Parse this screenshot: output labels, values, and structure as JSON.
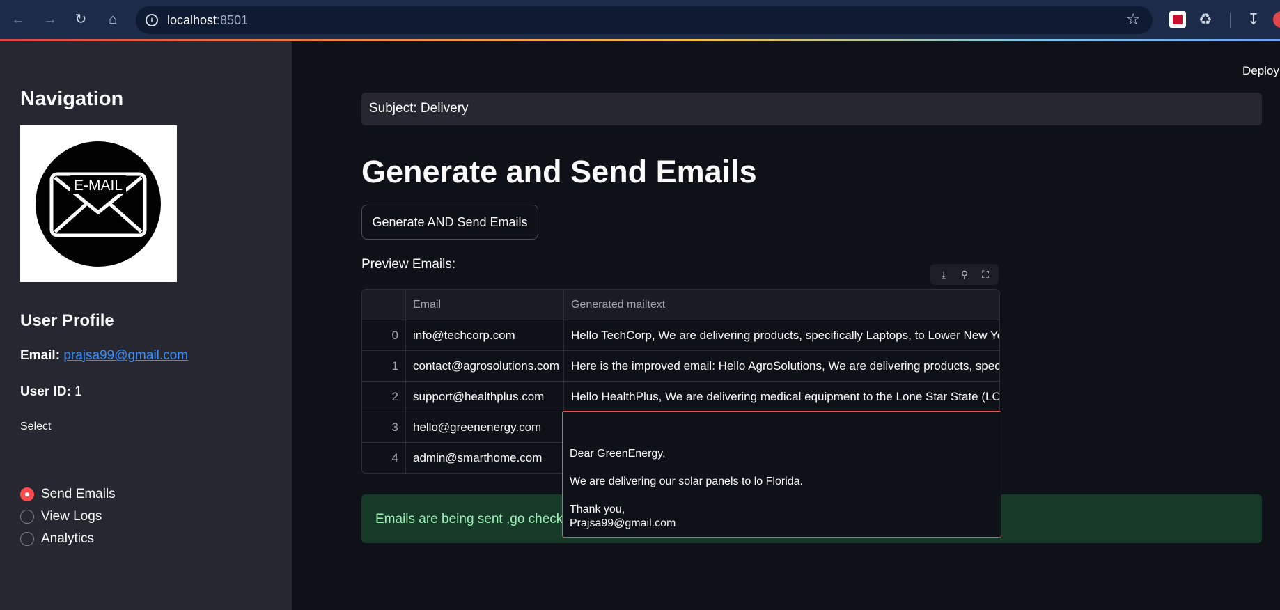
{
  "browser": {
    "url_host": "localhost",
    "url_port": ":8501",
    "back_icon": "arrow-left-icon",
    "forward_icon": "arrow-right-icon",
    "reload_icon": "reload-icon",
    "home_icon": "home-icon",
    "bookmark_icon": "star-icon"
  },
  "sidebar": {
    "nav_title": "Navigation",
    "logo_text": "E-MAIL",
    "profile_title": "User Profile",
    "email_label": "Email:",
    "email_value": "prajsa99@gmail.com",
    "userid_label": "User ID:",
    "userid_value": "1",
    "select_label": "Select",
    "options": [
      {
        "label": "Send Emails",
        "selected": true
      },
      {
        "label": "View Logs",
        "selected": false
      },
      {
        "label": "Analytics",
        "selected": false
      }
    ],
    "accent_color": "#ff4b4b"
  },
  "main": {
    "deploy_label": "Deploy",
    "subject": "Subject: Delivery",
    "title": "Generate and Send Emails",
    "generate_button": "Generate AND Send Emails",
    "preview_label": "Preview Emails:",
    "table": {
      "columns": [
        "",
        "Email",
        "Generated mailtext"
      ],
      "rows": [
        {
          "index": "0",
          "email": "info@techcorp.com",
          "text": "  Hello TechCorp,  We are delivering products, specifically Laptops, to Lower New York i"
        },
        {
          "index": "1",
          "email": "contact@agrosolutions.com",
          "text": "Here is the improved email:  Hello AgroSolutions,  We are delivering products, specific"
        },
        {
          "index": "2",
          "email": "support@healthplus.com",
          "text": "  Hello HealthPlus,  We are delivering medical equipment to the Lone Star State (LO) in"
        },
        {
          "index": "3",
          "email": "hello@greenenergy.com",
          "text": ""
        },
        {
          "index": "4",
          "email": "admin@smarthome.com",
          "text": ""
        }
      ]
    },
    "popup": {
      "greeting": "Dear GreenEnergy,",
      "body": "We are delivering our solar panels to lo Florida.",
      "closing": "Thank you,",
      "signature": "Prajsa99@gmail.com"
    },
    "success_message": "Emails are being sent ,go check l",
    "success_color": "#173928"
  }
}
